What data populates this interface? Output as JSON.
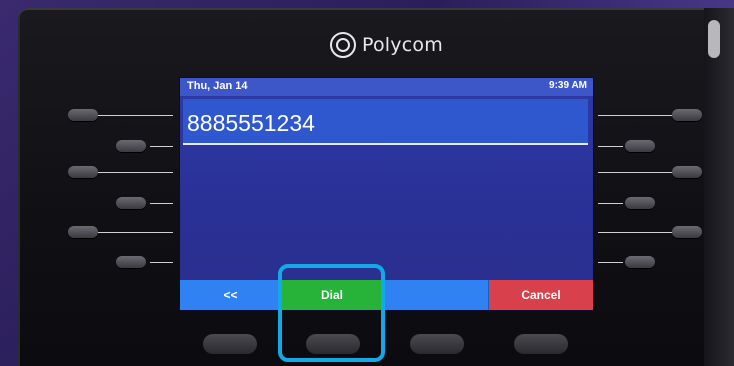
{
  "device": {
    "brand": "Polycom"
  },
  "screen": {
    "date": "Thu, Jan 14",
    "time": "9:39 AM",
    "dialed_number": "8885551234"
  },
  "softkeys": {
    "back": "<<",
    "dial": "Dial",
    "empty": "",
    "cancel": "Cancel"
  },
  "colors": {
    "screen_bg": "#2e3aa8",
    "status_bar": "#3d57c9",
    "softkey_blue": "#3082f2",
    "dial_green": "#27b23a",
    "cancel_red": "#d8404c",
    "highlight": "#13a8e8"
  }
}
